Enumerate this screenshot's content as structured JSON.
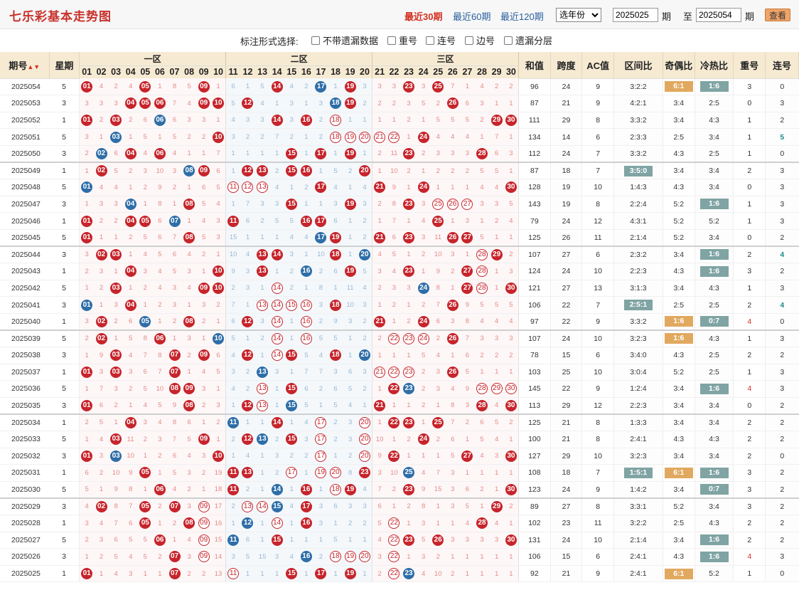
{
  "header": {
    "title": "七乐彩基本走势图",
    "quick_periods": [
      {
        "label": "最近30期",
        "active": true
      },
      {
        "label": "最近60期",
        "active": false
      },
      {
        "label": "最近120期",
        "active": false
      }
    ],
    "year_select": "选年份",
    "from_label": "期",
    "to_label": "至",
    "end_label": "期",
    "from_value": "2025025",
    "to_value": "2025054",
    "query_button": "查看"
  },
  "options": {
    "label": "标注形式选择:",
    "items": [
      "不带遗漏数据",
      "重号",
      "连号",
      "边号",
      "遗漏分层"
    ]
  },
  "table_header": {
    "period": "期号",
    "sort_icon": "sort-icon",
    "week": "星期",
    "zones": [
      "一区",
      "二区",
      "三区"
    ],
    "numbers": [
      "01",
      "02",
      "03",
      "04",
      "05",
      "06",
      "07",
      "08",
      "09",
      "10",
      "11",
      "12",
      "13",
      "14",
      "15",
      "16",
      "17",
      "18",
      "19",
      "20",
      "21",
      "22",
      "23",
      "24",
      "25",
      "26",
      "27",
      "28",
      "29",
      "30"
    ],
    "stats": [
      "和值",
      "跨度",
      "AC值",
      "区间比",
      "奇偶比",
      "冷热比",
      "重号",
      "连号"
    ]
  },
  "rows": [
    {
      "p": "2025054",
      "w": "5",
      "c": [
        "R01",
        "4",
        "2",
        "4",
        "R05",
        "1",
        "8",
        "5",
        "R09",
        "1",
        "6",
        "1",
        "5",
        "R14",
        "4",
        "2",
        "B17",
        "1",
        "R19",
        "3",
        "3",
        "3",
        "R23",
        "3",
        "R25",
        "7",
        "1",
        "4",
        "2",
        "2"
      ],
      "s": [
        "96",
        "24",
        "9",
        "3:2:2",
        "G6:1",
        "T1:6",
        "3",
        "0"
      ]
    },
    {
      "p": "2025053",
      "w": "3",
      "c": [
        "3",
        "3",
        "3",
        "R04",
        "R05",
        "R06",
        "7",
        "4",
        "R09",
        "R10",
        "5",
        "R12",
        "4",
        "1",
        "3",
        "1",
        "3",
        "B18",
        "R19",
        "2",
        "2",
        "2",
        "3",
        "5",
        "2",
        "R26",
        "6",
        "3",
        "1",
        "1"
      ],
      "s": [
        "87",
        "21",
        "9",
        "4:2:1",
        "3:4",
        "2:5",
        "0",
        "3"
      ]
    },
    {
      "p": "2025052",
      "w": "1",
      "c": [
        "R01",
        "2",
        "R03",
        "2",
        "6",
        "B06",
        "6",
        "3",
        "3",
        "1",
        "4",
        "3",
        "3",
        "R14",
        "3",
        "R16",
        "2",
        "O18",
        "1",
        "1",
        "1",
        "1",
        "2",
        "1",
        "5",
        "5",
        "5",
        "2",
        "R29",
        "R30"
      ],
      "s": [
        "111",
        "29",
        "8",
        "3:3:2",
        "3:4",
        "4:3",
        "1",
        "2"
      ]
    },
    {
      "p": "2025051",
      "w": "5",
      "c": [
        "3",
        "1",
        "B03",
        "1",
        "5",
        "1",
        "5",
        "2",
        "2",
        "R10",
        "3",
        "2",
        "2",
        "7",
        "2",
        "1",
        "2",
        "O18",
        "O19",
        "O20",
        "O21",
        "O22",
        "1",
        "R24",
        "4",
        "4",
        "4",
        "1",
        "7",
        "1"
      ],
      "s": [
        "134",
        "14",
        "6",
        "2:3:3",
        "2:5",
        "3:4",
        "1",
        "G5"
      ]
    },
    {
      "p": "2025050",
      "w": "3",
      "c": [
        "2",
        "B02",
        "6",
        "R04",
        "4",
        "R06",
        "4",
        "1",
        "1",
        "7",
        "1",
        "1",
        "1",
        "1",
        "R15",
        "1",
        "R17",
        "1",
        "R19",
        "1",
        "2",
        "11",
        "R23",
        "2",
        "3",
        "3",
        "3",
        "R28",
        "6",
        "3"
      ],
      "s": [
        "112",
        "24",
        "7",
        "3:3:2",
        "4:3",
        "2:5",
        "1",
        "0"
      ]
    },
    {
      "p": "2025049",
      "w": "1",
      "c": [
        "1",
        "R02",
        "5",
        "2",
        "3",
        "10",
        "3",
        "B08",
        "R09",
        "6",
        "1",
        "R12",
        "R13",
        "2",
        "R15",
        "R16",
        "1",
        "5",
        "2",
        "R20",
        "1",
        "10",
        "2",
        "1",
        "2",
        "2",
        "2",
        "5",
        "5",
        "1"
      ],
      "s": [
        "87",
        "18",
        "7",
        "T3:5:0",
        "3:4",
        "3:4",
        "2",
        "3"
      ]
    },
    {
      "p": "2025048",
      "w": "5",
      "c": [
        "B01",
        "4",
        "4",
        "1",
        "2",
        "9",
        "2",
        "1",
        "6",
        "5",
        "O11",
        "O12",
        "O13",
        "4",
        "1",
        "2",
        "R17",
        "4",
        "1",
        "4",
        "R21",
        "9",
        "1",
        "R24",
        "1",
        "1",
        "1",
        "4",
        "4",
        "R30"
      ],
      "s": [
        "128",
        "19",
        "10",
        "1:4:3",
        "4:3",
        "3:4",
        "0",
        "3"
      ]
    },
    {
      "p": "2025047",
      "w": "3",
      "c": [
        "1",
        "3",
        "3",
        "B04",
        "1",
        "8",
        "1",
        "R08",
        "5",
        "4",
        "1",
        "7",
        "3",
        "3",
        "R15",
        "1",
        "1",
        "3",
        "R19",
        "3",
        "2",
        "8",
        "R23",
        "3",
        "O25",
        "O26",
        "O27",
        "3",
        "3",
        "5"
      ],
      "s": [
        "143",
        "19",
        "8",
        "2:2:4",
        "5:2",
        "T1:6",
        "1",
        "3"
      ]
    },
    {
      "p": "2025046",
      "w": "1",
      "c": [
        "R01",
        "2",
        "2",
        "R04",
        "R05",
        "6",
        "B07",
        "1",
        "4",
        "3",
        "R11",
        "6",
        "2",
        "5",
        "5",
        "R16",
        "R17",
        "6",
        "1",
        "2",
        "1",
        "7",
        "1",
        "4",
        "R25",
        "1",
        "3",
        "1",
        "2",
        "4"
      ],
      "s": [
        "79",
        "24",
        "12",
        "4:3:1",
        "5:2",
        "5:2",
        "1",
        "3"
      ]
    },
    {
      "p": "2025045",
      "w": "5",
      "c": [
        "R01",
        "1",
        "1",
        "2",
        "5",
        "6",
        "7",
        "R08",
        "5",
        "3",
        "15",
        "1",
        "1",
        "1",
        "4",
        "4",
        "B17",
        "R19",
        "1",
        "2",
        "R21",
        "6",
        "R23",
        "3",
        "11",
        "R26",
        "R27",
        "5",
        "1",
        "1"
      ],
      "s": [
        "125",
        "26",
        "11",
        "2:1:4",
        "5:2",
        "3:4",
        "0",
        "2"
      ]
    },
    {
      "p": "2025044",
      "w": "3",
      "c": [
        "3",
        "R02",
        "R03",
        "1",
        "4",
        "5",
        "6",
        "4",
        "2",
        "1",
        "10",
        "4",
        "R13",
        "R14",
        "3",
        "1",
        "10",
        "R18",
        "1",
        "B20",
        "4",
        "5",
        "1",
        "2",
        "10",
        "3",
        "1",
        "O28",
        "R29",
        "2"
      ],
      "s": [
        "107",
        "27",
        "6",
        "2:3:2",
        "3:4",
        "T1:6",
        "2",
        "G4"
      ]
    },
    {
      "p": "2025043",
      "w": "1",
      "c": [
        "2",
        "3",
        "1",
        "R04",
        "3",
        "4",
        "5",
        "3",
        "1",
        "R10",
        "9",
        "3",
        "R13",
        "1",
        "2",
        "B16",
        "2",
        "6",
        "R19",
        "5",
        "3",
        "4",
        "R23",
        "1",
        "9",
        "2",
        "R27",
        "O28",
        "1",
        "3"
      ],
      "s": [
        "124",
        "24",
        "10",
        "2:2:3",
        "4:3",
        "T1:6",
        "3",
        "2"
      ]
    },
    {
      "p": "2025042",
      "w": "5",
      "c": [
        "1",
        "2",
        "R03",
        "1",
        "2",
        "4",
        "3",
        "4",
        "R09",
        "R10",
        "2",
        "3",
        "1",
        "O14",
        "2",
        "1",
        "8",
        "1",
        "11",
        "4",
        "2",
        "3",
        "3",
        "B24",
        "8",
        "1",
        "R27",
        "O28",
        "1",
        "R30"
      ],
      "s": [
        "121",
        "27",
        "13",
        "3:1:3",
        "3:4",
        "4:3",
        "1",
        "3"
      ]
    },
    {
      "p": "2025041",
      "w": "3",
      "c": [
        "B01",
        "1",
        "3",
        "R04",
        "1",
        "2",
        "3",
        "1",
        "3",
        "2",
        "7",
        "1",
        "O13",
        "O14",
        "O15",
        "O16",
        "3",
        "R18",
        "10",
        "3",
        "1",
        "2",
        "1",
        "2",
        "7",
        "R26",
        "9",
        "5",
        "5",
        "5"
      ],
      "s": [
        "106",
        "22",
        "7",
        "T2:5:1",
        "2:5",
        "2:5",
        "2",
        "G4"
      ]
    },
    {
      "p": "2025040",
      "w": "1",
      "c": [
        "3",
        "R02",
        "2",
        "6",
        "B05",
        "1",
        "2",
        "R08",
        "2",
        "1",
        "6",
        "R12",
        "3",
        "O14",
        "1",
        "O16",
        "2",
        "9",
        "3",
        "2",
        "R21",
        "1",
        "2",
        "R24",
        "6",
        "3",
        "8",
        "4",
        "4",
        "4"
      ],
      "s": [
        "97",
        "22",
        "9",
        "3:3:2",
        "G1:6",
        "T0:7",
        "r4",
        "0"
      ]
    },
    {
      "p": "2025039",
      "w": "5",
      "c": [
        "2",
        "R02",
        "1",
        "5",
        "8",
        "R06",
        "1",
        "3",
        "1",
        "B10",
        "5",
        "1",
        "2",
        "O14",
        "1",
        "O16",
        "5",
        "5",
        "1",
        "2",
        "2",
        "O22",
        "O23",
        "O24",
        "2",
        "R26",
        "7",
        "3",
        "3",
        "3"
      ],
      "s": [
        "107",
        "24",
        "10",
        "3:2:3",
        "G1:6",
        "4:3",
        "1",
        "3"
      ]
    },
    {
      "p": "2025038",
      "w": "3",
      "c": [
        "1",
        "9",
        "R03",
        "4",
        "7",
        "8",
        "R07",
        "2",
        "R09",
        "6",
        "4",
        "R12",
        "1",
        "O14",
        "R15",
        "5",
        "4",
        "R18",
        "1",
        "B20",
        "1",
        "1",
        "1",
        "5",
        "4",
        "1",
        "6",
        "2",
        "2",
        "2"
      ],
      "s": [
        "78",
        "15",
        "6",
        "3:4:0",
        "4:3",
        "2:5",
        "2",
        "2"
      ]
    },
    {
      "p": "2025037",
      "w": "1",
      "c": [
        "R01",
        "3",
        "R03",
        "3",
        "6",
        "7",
        "R07",
        "1",
        "4",
        "5",
        "3",
        "2",
        "B13",
        "3",
        "1",
        "7",
        "7",
        "3",
        "6",
        "3",
        "O21",
        "O22",
        "O23",
        "2",
        "3",
        "R26",
        "5",
        "1",
        "1",
        "1"
      ],
      "s": [
        "103",
        "25",
        "10",
        "3:0:4",
        "5:2",
        "2:5",
        "1",
        "3"
      ]
    },
    {
      "p": "2025036",
      "w": "5",
      "c": [
        "1",
        "7",
        "3",
        "2",
        "5",
        "10",
        "R08",
        "R09",
        "3",
        "1",
        "4",
        "2",
        "O13",
        "1",
        "R15",
        "6",
        "2",
        "6",
        "5",
        "2",
        "1",
        "R22",
        "B23",
        "2",
        "3",
        "4",
        "9",
        "O28",
        "O29",
        "O30"
      ],
      "s": [
        "145",
        "22",
        "9",
        "1:2:4",
        "3:4",
        "T1:6",
        "r4",
        "3"
      ]
    },
    {
      "p": "2025035",
      "w": "3",
      "c": [
        "R01",
        "6",
        "2",
        "1",
        "4",
        "5",
        "9",
        "R08",
        "2",
        "3",
        "1",
        "R12",
        "O13",
        "1",
        "B15",
        "5",
        "1",
        "5",
        "4",
        "1",
        "R21",
        "1",
        "1",
        "2",
        "1",
        "8",
        "3",
        "R28",
        "4",
        "R30"
      ],
      "s": [
        "113",
        "29",
        "12",
        "2:2:3",
        "3:4",
        "3:4",
        "0",
        "2"
      ]
    },
    {
      "p": "2025034",
      "w": "1",
      "c": [
        "2",
        "5",
        "1",
        "R04",
        "3",
        "4",
        "8",
        "6",
        "1",
        "2",
        "B11",
        "1",
        "1",
        "R14",
        "1",
        "4",
        "O17",
        "2",
        "3",
        "O20",
        "1",
        "R22",
        "R23",
        "1",
        "R25",
        "7",
        "2",
        "6",
        "5",
        "2"
      ],
      "s": [
        "125",
        "21",
        "8",
        "1:3:3",
        "3:4",
        "3:4",
        "2",
        "2"
      ]
    },
    {
      "p": "2025033",
      "w": "5",
      "c": [
        "1",
        "4",
        "R03",
        "11",
        "2",
        "3",
        "7",
        "5",
        "R09",
        "1",
        "2",
        "R12",
        "B13",
        "2",
        "R15",
        "3",
        "O17",
        "2",
        "3",
        "O20",
        "10",
        "1",
        "2",
        "R24",
        "2",
        "6",
        "1",
        "5",
        "4",
        "1"
      ],
      "s": [
        "100",
        "21",
        "8",
        "2:4:1",
        "4:3",
        "4:3",
        "2",
        "2"
      ]
    },
    {
      "p": "2025032",
      "w": "3",
      "c": [
        "R01",
        "3",
        "B03",
        "10",
        "1",
        "2",
        "6",
        "4",
        "3",
        "R10",
        "1",
        "4",
        "1",
        "3",
        "2",
        "2",
        "O17",
        "1",
        "2",
        "O20",
        "9",
        "R22",
        "1",
        "1",
        "1",
        "5",
        "R27",
        "4",
        "3",
        "R30"
      ],
      "s": [
        "127",
        "29",
        "10",
        "3:2:3",
        "3:4",
        "3:4",
        "2",
        "0"
      ]
    },
    {
      "p": "2025031",
      "w": "1",
      "c": [
        "6",
        "2",
        "10",
        "9",
        "R05",
        "1",
        "5",
        "3",
        "2",
        "19",
        "R11",
        "R13",
        "1",
        "2",
        "O17",
        "1",
        "O19",
        "O20",
        "8",
        "R23",
        "3",
        "10",
        "B25",
        "4",
        "7",
        "3",
        "1",
        "1",
        "1",
        "1"
      ],
      "s": [
        "108",
        "18",
        "7",
        "T1:5:1",
        "G6:1",
        "T1:6",
        "3",
        "2"
      ]
    },
    {
      "p": "2025030",
      "w": "5",
      "c": [
        "5",
        "1",
        "9",
        "8",
        "1",
        "R06",
        "4",
        "2",
        "1",
        "18",
        "R11",
        "2",
        "1",
        "B14",
        "1",
        "R16",
        "1",
        "O18",
        "R19",
        "4",
        "7",
        "2",
        "R23",
        "9",
        "15",
        "3",
        "6",
        "2",
        "1",
        "R30"
      ],
      "s": [
        "123",
        "24",
        "9",
        "1:4:2",
        "3:4",
        "T0:7",
        "3",
        "2"
      ]
    },
    {
      "p": "2025029",
      "w": "3",
      "c": [
        "4",
        "R02",
        "8",
        "7",
        "R05",
        "2",
        "R07",
        "3",
        "O09",
        "17",
        "2",
        "O13",
        "O14",
        "B15",
        "4",
        "R17",
        "3",
        "6",
        "3",
        "3",
        "6",
        "1",
        "2",
        "8",
        "1",
        "3",
        "5",
        "1",
        "R29",
        "2"
      ],
      "s": [
        "89",
        "27",
        "8",
        "3:3:1",
        "5:2",
        "3:4",
        "3",
        "2"
      ]
    },
    {
      "p": "2025028",
      "w": "1",
      "c": [
        "3",
        "4",
        "7",
        "6",
        "R05",
        "1",
        "2",
        "R08",
        "O09",
        "16",
        "1",
        "B12",
        "1",
        "O14",
        "1",
        "R16",
        "3",
        "1",
        "2",
        "2",
        "5",
        "O22",
        "1",
        "3",
        "1",
        "1",
        "4",
        "R28",
        "4",
        "1"
      ],
      "s": [
        "102",
        "23",
        "11",
        "3:2:2",
        "2:5",
        "4:3",
        "2",
        "2"
      ]
    },
    {
      "p": "2025027",
      "w": "5",
      "c": [
        "2",
        "3",
        "6",
        "5",
        "5",
        "R06",
        "1",
        "4",
        "O09",
        "15",
        "B11",
        "6",
        "1",
        "R15",
        "1",
        "1",
        "1",
        "5",
        "1",
        "1",
        "4",
        "O22",
        "R23",
        "5",
        "R26",
        "3",
        "3",
        "3",
        "3",
        "R30"
      ],
      "s": [
        "131",
        "24",
        "10",
        "2:1:4",
        "3:4",
        "T1:6",
        "2",
        "2"
      ]
    },
    {
      "p": "2025026",
      "w": "3",
      "c": [
        "1",
        "2",
        "5",
        "4",
        "5",
        "2",
        "R07",
        "3",
        "O09",
        "14",
        "3",
        "5",
        "15",
        "3",
        "4",
        "B16",
        "2",
        "O18",
        "O19",
        "O20",
        "3",
        "O22",
        "1",
        "3",
        "2",
        "1",
        "1",
        "1",
        "1",
        "1"
      ],
      "s": [
        "106",
        "15",
        "6",
        "2:4:1",
        "4:3",
        "T1:6",
        "r4",
        "3"
      ]
    },
    {
      "p": "2025025",
      "w": "1",
      "c": [
        "R01",
        "1",
        "4",
        "3",
        "1",
        "1",
        "R07",
        "2",
        "2",
        "13",
        "O11",
        "1",
        "1",
        "1",
        "R15",
        "1",
        "R17",
        "1",
        "R19",
        "1",
        "2",
        "O22",
        "B23",
        "4",
        "10",
        "2",
        "1",
        "1",
        "1",
        "1"
      ],
      "s": [
        "92",
        "21",
        "9",
        "2:4:1",
        "G6:1",
        "5:2",
        "1",
        "0"
      ]
    }
  ]
}
